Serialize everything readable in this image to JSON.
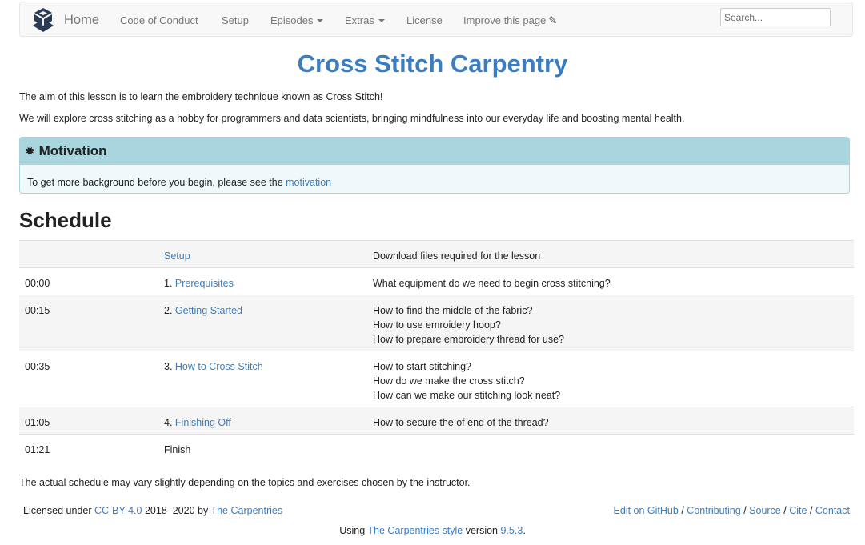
{
  "navbar": {
    "brand_label": "Home",
    "items": [
      "Code of Conduct",
      "Setup",
      "Episodes",
      "Extras",
      "License",
      "Improve this page"
    ],
    "search_placeholder": "Search..."
  },
  "page": {
    "title": "Cross Stitch Carpentry",
    "intro": "The aim of this lesson is to learn the embroidery technique known as Cross Stitch!",
    "description": "We will explore cross stitching as a hobby for programmers and data scientists, bringing mindfulness into our everyday life and boosting mental health."
  },
  "callout": {
    "title": "Motivation",
    "text": "To get more background before you begin, please see the ",
    "link": "motivation"
  },
  "schedule": {
    "heading": "Schedule",
    "rows": [
      {
        "time": "",
        "num": "",
        "episode": "Setup",
        "questions": [
          "Download files required for the lesson"
        ]
      },
      {
        "time": "00:00",
        "num": "1. ",
        "episode": "Prerequisites",
        "questions": [
          "What equipment do we need to begin cross stitching?"
        ]
      },
      {
        "time": "00:15",
        "num": "2. ",
        "episode": "Getting Started",
        "questions": [
          "How to find the middle of the fabric?",
          "How to use emroidery hoop?",
          "How to prepare embroidery thread for use?"
        ]
      },
      {
        "time": "00:35",
        "num": "3. ",
        "episode": "How to Cross Stitch",
        "questions": [
          "How to start stitching?",
          "How do we make the cross stitch?",
          "How can we make our stitching look neat?"
        ]
      },
      {
        "time": "01:05",
        "num": "4. ",
        "episode": "Finishing Off",
        "questions": [
          "How to secure the of end of the thread?"
        ]
      },
      {
        "time": "01:21",
        "num": "",
        "episode": "Finish",
        "questions": []
      }
    ],
    "note": "The actual schedule may vary slightly depending on the topics and exercises chosen by the instructor."
  },
  "footer": {
    "licensed_under": "Licensed under",
    "license_link": "CC-BY 4.0",
    "years_by": "2018–2020 by",
    "author_link": "The Carpentries",
    "right_links": [
      "Edit on GitHub",
      "Contributing",
      "Source",
      "Cite",
      "Contact"
    ],
    "separator": "/",
    "using": "Using",
    "style_link": "The Carpentries style",
    "version_label": "version",
    "version": "9.5.3",
    "period": "."
  },
  "colors": {
    "link": "#3b7dbf",
    "callout_header": "#a9d5de",
    "callout_body": "#eff8fa",
    "row_shade": "#f5f5f5"
  }
}
